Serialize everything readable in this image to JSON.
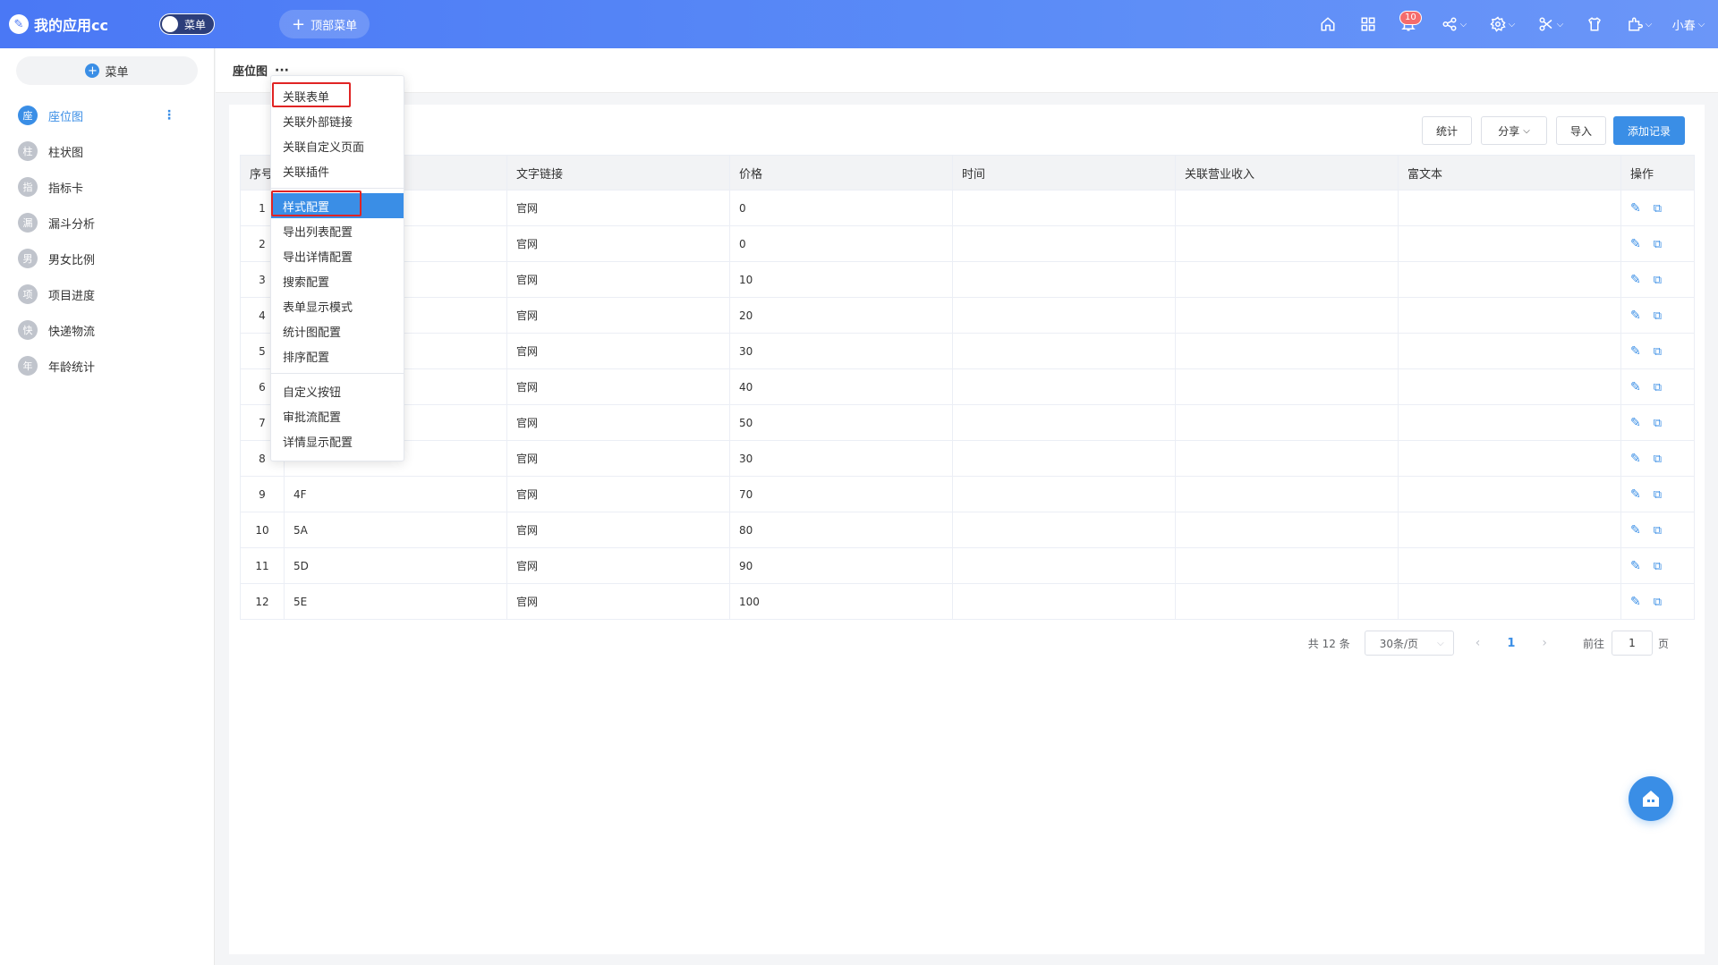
{
  "app": {
    "title": "我的应用cc",
    "toggle_label": "菜单",
    "top_menu_label": "顶部菜单"
  },
  "topbar": {
    "notification_count": "10",
    "user_name": "小春",
    "icons": [
      "home-icon",
      "apps-icon",
      "bell-icon",
      "share-icon",
      "settings-icon",
      "tools-icon",
      "shirt-icon",
      "plugin-icon"
    ]
  },
  "sidebar": {
    "add_label": "菜单",
    "items": [
      {
        "icon_char": "座",
        "label": "座位图",
        "active": true
      },
      {
        "icon_char": "柱",
        "label": "柱状图"
      },
      {
        "icon_char": "指",
        "label": "指标卡"
      },
      {
        "icon_char": "漏",
        "label": "漏斗分析"
      },
      {
        "icon_char": "男",
        "label": "男女比例"
      },
      {
        "icon_char": "项",
        "label": "项目进度"
      },
      {
        "icon_char": "快",
        "label": "快递物流"
      },
      {
        "icon_char": "年",
        "label": "年龄统计"
      }
    ]
  },
  "page": {
    "title": "座位图",
    "more": "···"
  },
  "toolbar": {
    "stats": "统计",
    "share": "分享",
    "import": "导入",
    "add_record": "添加记录"
  },
  "table": {
    "headers": [
      "序号",
      "",
      "文字链接",
      "价格",
      "时间",
      "关联营业收入",
      "富文本",
      "操作"
    ],
    "rows": [
      {
        "idx": "1",
        "name": "",
        "link": "官网",
        "price": "0"
      },
      {
        "idx": "2",
        "name": "",
        "link": "官网",
        "price": "0"
      },
      {
        "idx": "3",
        "name": "",
        "link": "官网",
        "price": "10"
      },
      {
        "idx": "4",
        "name": "",
        "link": "官网",
        "price": "20"
      },
      {
        "idx": "5",
        "name": "",
        "link": "官网",
        "price": "30"
      },
      {
        "idx": "6",
        "name": "",
        "link": "官网",
        "price": "40"
      },
      {
        "idx": "7",
        "name": "",
        "link": "官网",
        "price": "50"
      },
      {
        "idx": "8",
        "name": "",
        "link": "官网",
        "price": "30"
      },
      {
        "idx": "9",
        "name": "4F",
        "link": "官网",
        "price": "70"
      },
      {
        "idx": "10",
        "name": "5A",
        "link": "官网",
        "price": "80"
      },
      {
        "idx": "11",
        "name": "5D",
        "link": "官网",
        "price": "90"
      },
      {
        "idx": "12",
        "name": "5E",
        "link": "官网",
        "price": "100"
      }
    ]
  },
  "pagination": {
    "total": "共 12 条",
    "page_size": "30条/页",
    "current": "1",
    "goto_label": "前往",
    "goto_value": "1",
    "page_unit": "页"
  },
  "dropdown": {
    "groups": [
      [
        "关联表单",
        "关联外部链接",
        "关联自定义页面",
        "关联插件"
      ],
      [
        "样式配置",
        "导出列表配置",
        "导出详情配置",
        "搜索配置",
        "表单显示模式",
        "统计图配置",
        "排序配置"
      ],
      [
        "自定义按钮",
        "审批流配置",
        "详情显示配置"
      ]
    ],
    "selected": "样式配置"
  }
}
